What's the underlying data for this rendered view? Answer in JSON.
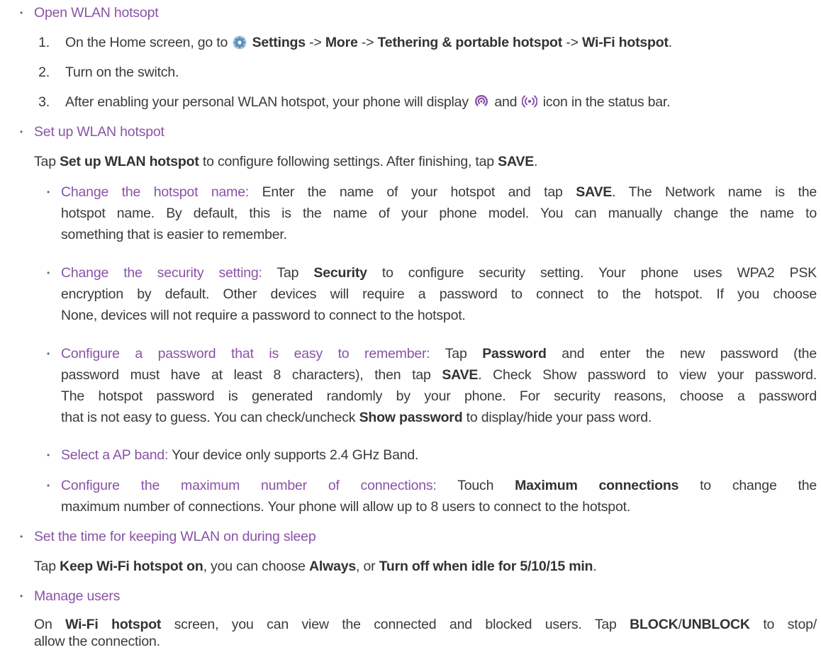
{
  "sections": [
    {
      "heading": "Open WLAN hotsopt",
      "steps": [
        {
          "num": "1.",
          "pre": "On the Home screen, go to",
          "settings": "Settings",
          "arrow1": " -> ",
          "more": "More",
          "arrow2": " -> ",
          "tethering": "Tethering & portable hotspot",
          "arrow3": "  -> ",
          "wifi": "Wi-Fi hotspot",
          "end": "."
        },
        {
          "num": "2.",
          "text": "Turn on the switch."
        },
        {
          "num": "3.",
          "pre": "After enabling your personal WLAN hotspot, your phone will display",
          "mid": "and",
          "post": "icon in the status bar."
        }
      ]
    },
    {
      "heading": "Set up WLAN hotspot",
      "intro": {
        "pre": "Tap ",
        "bold": "Set up WLAN hotspot",
        "post": " to configure following settings. After finishing, tap ",
        "bold2": "SAVE",
        "end": "."
      },
      "items": [
        {
          "label": "Change the hotspot name:",
          "line1_pre": " Enter the name of your hotspot and tap ",
          "line1_bold": "SAVE",
          "line1_post": ". The Network name is the",
          "line2": "hotspot name. By default, this is the name of your phone model. You can manually change the name to",
          "line3": "something that is easier to remember."
        },
        {
          "label": "Change the security setting:",
          "line1_pre": " Tap ",
          "line1_bold": "Security",
          "line1_post": " to configure security setting. Your phone uses WPA2 PSK",
          "line2": "encryption by default. Other devices will require a password to connect to the hotspot. If you choose",
          "line3": "None, devices will not require a password to connect to the hotspot."
        },
        {
          "label": "Configure a password that is easy to remember:",
          "line1_pre": " Tap ",
          "line1_bold": "Password",
          "line1_post": " and enter the new password (the",
          "line2_pre": "password must have at least 8 characters), then tap ",
          "line2_bold": "SAVE",
          "line2_post": ". Check Show password to view your password.",
          "line3": "The hotspot password is generated randomly by your phone. For security reasons, choose a password",
          "line4_pre": "that is not easy to guess. You can check/uncheck ",
          "line4_bold": "Show password",
          "line4_post": " to display/hide your pass word."
        },
        {
          "label": "Select a AP band:",
          "line1": " Your device only supports 2.4 GHz Band."
        },
        {
          "label": "Configure the maximum number of connections:",
          "line1_pre": " Touch ",
          "line1_bold": "Maximum connections",
          "line1_post": " to change the",
          "line2": "maximum number of connections. Your phone will allow up to 8 users to connect to the hotspot."
        }
      ]
    },
    {
      "heading": "Set the time for keeping WLAN on during sleep",
      "body": {
        "pre": "Tap ",
        "bold1": "Keep Wi-Fi hotspot on",
        "mid": ", you can choose ",
        "bold2": "Always",
        "mid2": ", or ",
        "bold3": "Turn off when idle for 5/10/15 min",
        "end": "."
      }
    },
    {
      "heading": "Manage users",
      "body": {
        "pre": "On ",
        "bold1": "Wi-Fi hotspot",
        "mid": " screen, you can view the connected and blocked users. Tap ",
        "bold2": "BLOCK",
        "slash": "/",
        "bold3": "UNBLOCK",
        "post": " to stop/",
        "line2": "allow the connection."
      }
    }
  ],
  "bullet": "•",
  "colors": {
    "accent": "#8a53a6",
    "text": "#3a3a3a",
    "icon": "#8a53a6"
  },
  "icons": [
    "settings-gear-icon",
    "hotspot-icon",
    "wifi-broadcast-icon"
  ]
}
